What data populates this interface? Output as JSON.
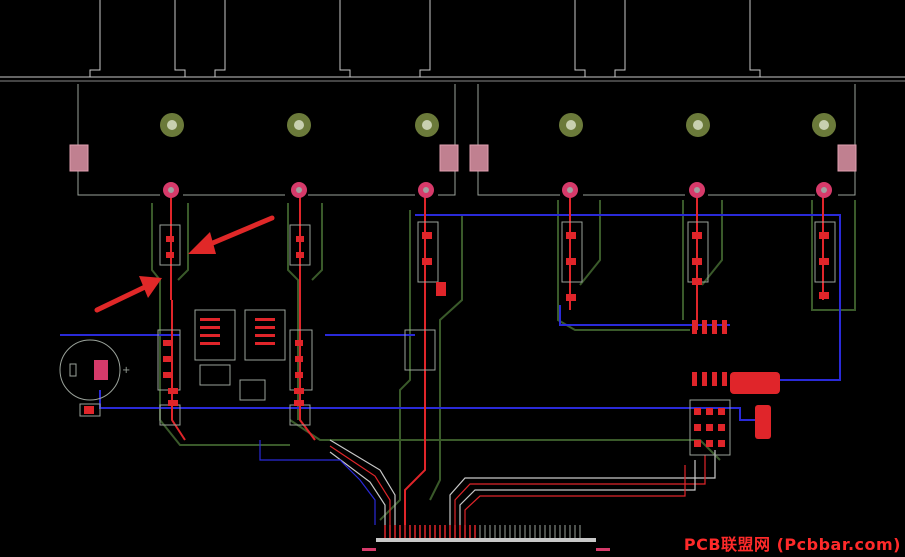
{
  "app": {
    "view": "PCB layout canvas (dark theme)"
  },
  "colors": {
    "background": "#000000",
    "board_outline": "#c8c8c8",
    "component_outline": "#9aa29a",
    "top_copper": "#e0252a",
    "bottom_copper": "#2a2ad8",
    "ground_pour_edge": "#3a5a2a",
    "pad_fill": "#d63a6a",
    "pad_light": "#c08090",
    "mounting_hole": "#6b7a3a",
    "silkscreen_mark": "#9aa",
    "annotation_arrow": "#e02828",
    "watermark": "#ff2a2a"
  },
  "icons": {
    "mounting_hole": "mounting-hole-icon",
    "via": "via-icon",
    "arrow": "annotation-arrow-icon",
    "polarity_plus": "polarity-plus-icon"
  },
  "labels": {
    "polarity_mark": "+",
    "watermark_text": "PCB联盟网 (Pcbbar.com)"
  },
  "annotations": {
    "arrow_count": 2
  }
}
